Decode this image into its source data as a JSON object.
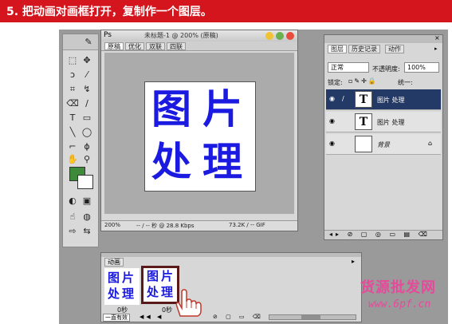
{
  "header": {
    "title": "5. 把动画对画框打开，复制作一个图层。"
  },
  "document": {
    "title": "未标题-1 @ 200% (原稿)",
    "tabs": [
      "原稿",
      "优化",
      "双联",
      "四联"
    ],
    "canvas_chars": [
      "图",
      "片",
      "处",
      "理"
    ],
    "status": {
      "zoom": "200%",
      "speed": "-- / -- 秒 @ 28.8 Kbps",
      "size": "73.2K / -- GIF"
    }
  },
  "layers_panel": {
    "tabs": [
      "图层",
      "历史记录",
      "动作"
    ],
    "blend_mode": "正常",
    "opacity_label": "不透明度:",
    "opacity_value": "100%",
    "lock_label": "锁定:",
    "unify_label": "统一:",
    "layers": [
      {
        "name": "图片 处理",
        "thumb": "T",
        "selected": true
      },
      {
        "name": "图片 处理",
        "thumb": "T",
        "selected": false
      },
      {
        "name": "背景",
        "thumb": "",
        "selected": false
      }
    ]
  },
  "animation_panel": {
    "tab": "动画",
    "frames": [
      {
        "chars": [
          "图",
          "片",
          "处",
          "理"
        ],
        "delay": "0秒"
      },
      {
        "chars": [
          "图",
          "片",
          "处",
          "理"
        ],
        "delay": "0秒"
      }
    ],
    "loop": "一直有效"
  },
  "watermark": {
    "line1": "货源批发网",
    "line2": "www.6pf.cn"
  },
  "colors": {
    "banner": "#d4151d",
    "text_blue": "#1a1ae0",
    "selected_layer": "#243a66",
    "watermark": "#e64a9a"
  }
}
